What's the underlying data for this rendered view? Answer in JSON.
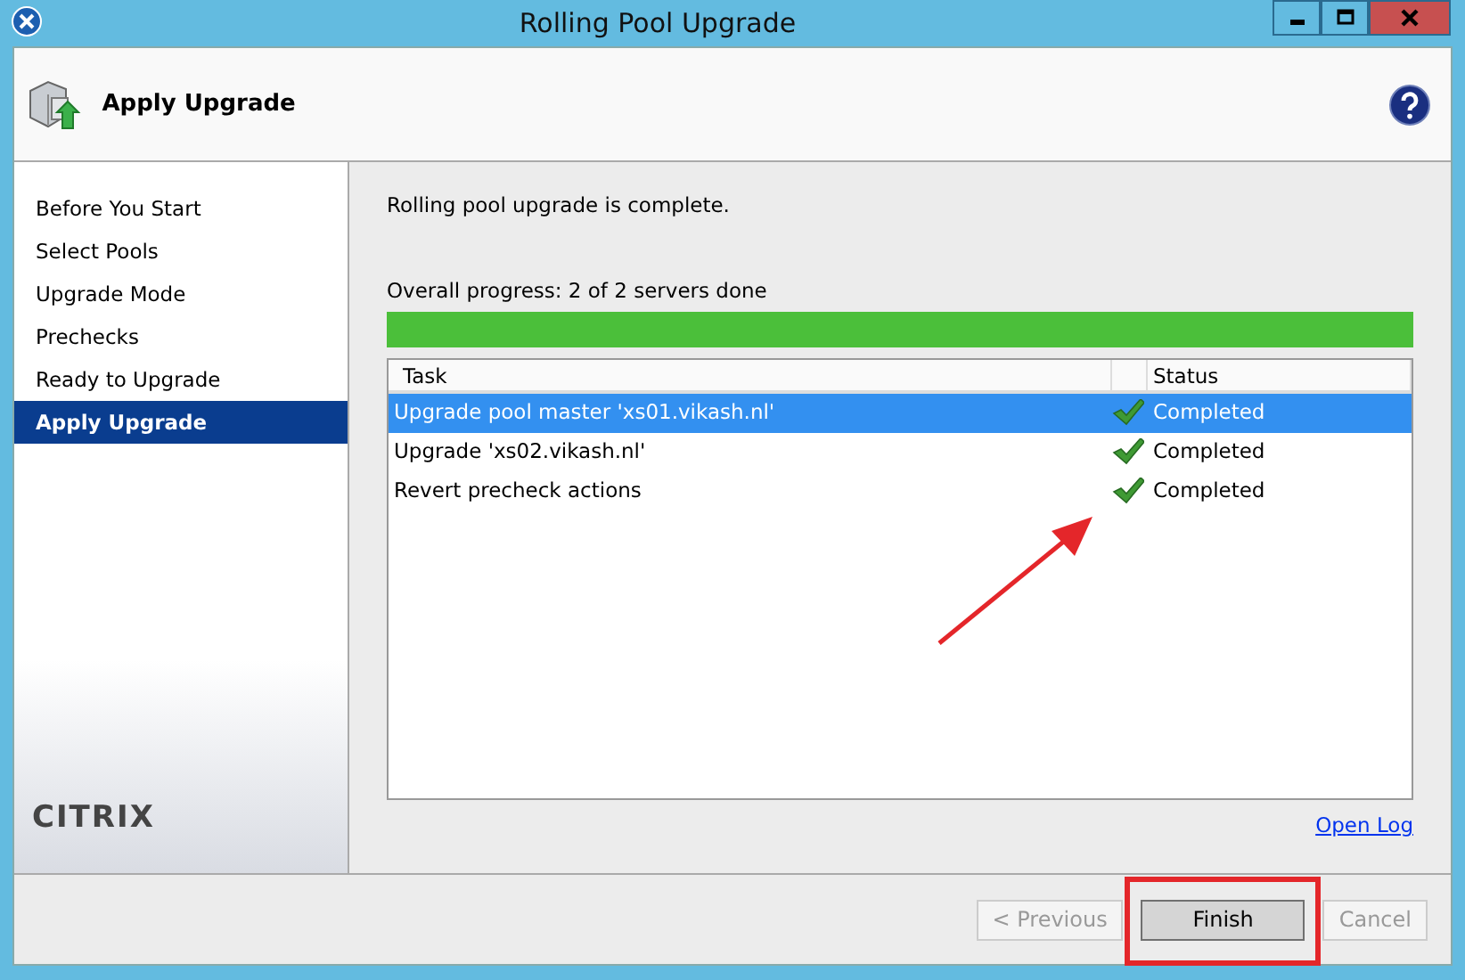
{
  "window": {
    "title": "Rolling Pool Upgrade"
  },
  "header": {
    "title": "Apply Upgrade"
  },
  "steps": [
    {
      "label": "Before You Start",
      "selected": false
    },
    {
      "label": "Select Pools",
      "selected": false
    },
    {
      "label": "Upgrade Mode",
      "selected": false
    },
    {
      "label": "Prechecks",
      "selected": false
    },
    {
      "label": "Ready to Upgrade",
      "selected": false
    },
    {
      "label": "Apply Upgrade",
      "selected": true
    }
  ],
  "logo": "CITRIX",
  "message": "Rolling pool upgrade is complete.",
  "progress": {
    "label": "Overall progress: 2 of 2 servers done",
    "level": 1
  },
  "table": {
    "columns": [
      "Task",
      "Status"
    ],
    "rows": [
      {
        "task": "Upgrade pool master 'xs01.vikash.nl'",
        "status": "Completed",
        "completed": true,
        "selected": true
      },
      {
        "task": "Upgrade 'xs02.vikash.nl'",
        "status": "Completed",
        "completed": true,
        "selected": false
      },
      {
        "task": "Revert precheck actions",
        "status": "Completed",
        "completed": true,
        "selected": false
      }
    ]
  },
  "open_log": "Open Log",
  "buttons": [
    {
      "label": "< Previous",
      "disabled": true,
      "highlighted": false
    },
    {
      "label": "Finish",
      "disabled": false,
      "highlighted": true
    },
    {
      "label": "Cancel",
      "disabled": true,
      "highlighted": false
    }
  ]
}
